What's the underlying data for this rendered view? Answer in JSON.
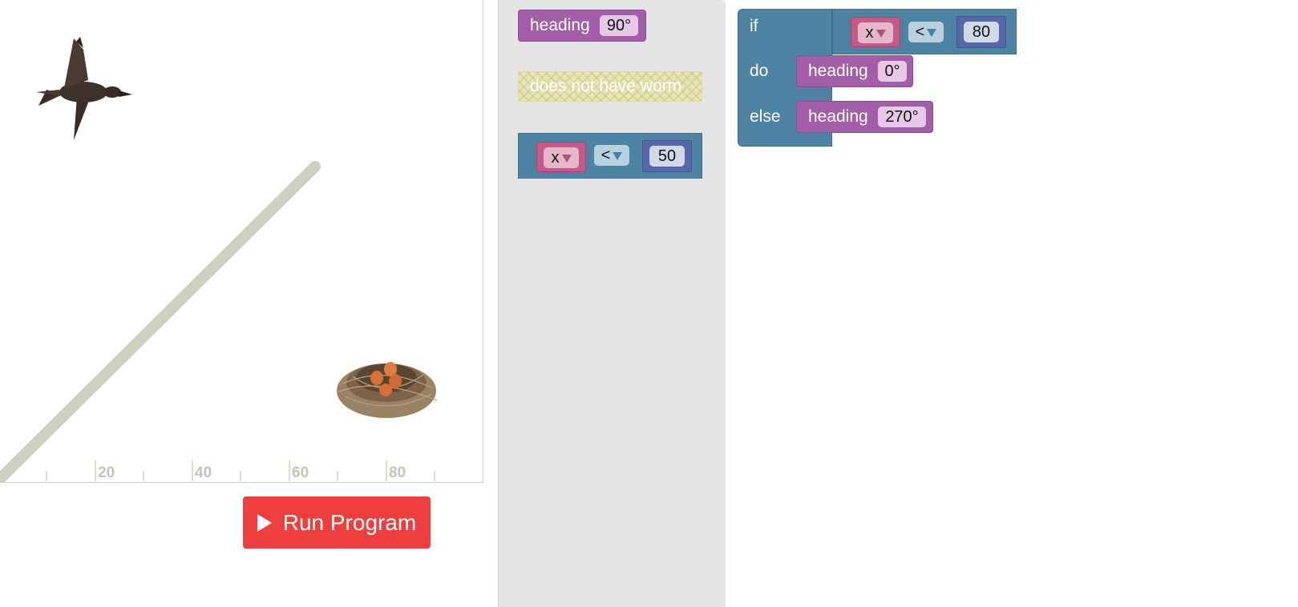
{
  "stage": {
    "axis_ticks": [
      "20",
      "40",
      "60",
      "80"
    ],
    "bird_icon": "duck-flying-icon",
    "nest_icon": "bird-nest-with-eggs-icon"
  },
  "run_button": {
    "label": "Run Program"
  },
  "toolbox": {
    "heading_block": {
      "label": "heading",
      "value": "90°"
    },
    "worm_block": {
      "label": "does not have worm"
    },
    "compare_block": {
      "var": "x",
      "op": "<",
      "value": "50"
    }
  },
  "workspace": {
    "if_label": "if",
    "do_label": "do",
    "else_label": "else",
    "condition": {
      "var": "x",
      "op": "<",
      "value": "80"
    },
    "do_block": {
      "label": "heading",
      "value": "0°"
    },
    "else_block": {
      "label": "heading",
      "value": "270°"
    }
  },
  "colors": {
    "run_button": "#ee3e3e",
    "motion_block": "#a35ea8",
    "logic_block": "#4d84a3",
    "variable_block": "#c55a88",
    "number_block": "#5567a8",
    "path": "#cfcfc0"
  }
}
